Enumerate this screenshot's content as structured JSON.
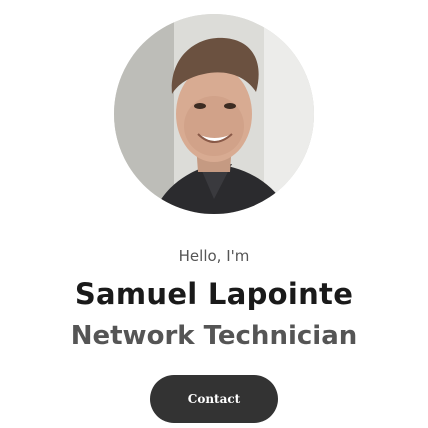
{
  "profile": {
    "greeting": "Hello, I'm",
    "name": "Samuel Lapointe",
    "role": "Network Technician",
    "photo_description": "profile-photo"
  },
  "actions": {
    "contact_label": "Contact"
  },
  "colors": {
    "background": "#ffffff",
    "button": "#333333",
    "button_text": "#ffffff",
    "heading": "#1a1a1a",
    "subtext": "#555555"
  }
}
